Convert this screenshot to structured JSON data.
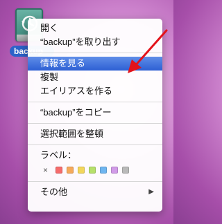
{
  "desktop": {
    "drive_icon": "time-machine-backup-drive-icon",
    "label": "backup"
  },
  "menu": {
    "items": [
      {
        "label": "開く"
      },
      {
        "label": "“backup”を取り出す"
      },
      {
        "label": "情報を見る",
        "highlighted": true
      },
      {
        "label": "複製"
      },
      {
        "label": "エイリアスを作る"
      },
      {
        "label": "“backup”をコピー"
      },
      {
        "label": "選択範囲を整頓"
      },
      {
        "label": "ラベル："
      },
      {
        "label": "その他"
      }
    ],
    "label_clear": "×",
    "label_colors": [
      "#f56b6b",
      "#f5a95a",
      "#f2d65a",
      "#b6e06a",
      "#6fb6f0",
      "#d19be8",
      "#b9b9b9"
    ],
    "submenu_arrow": "▶"
  },
  "colors": {
    "highlight": "#2d5fd3",
    "arrow": "#e3131b"
  }
}
